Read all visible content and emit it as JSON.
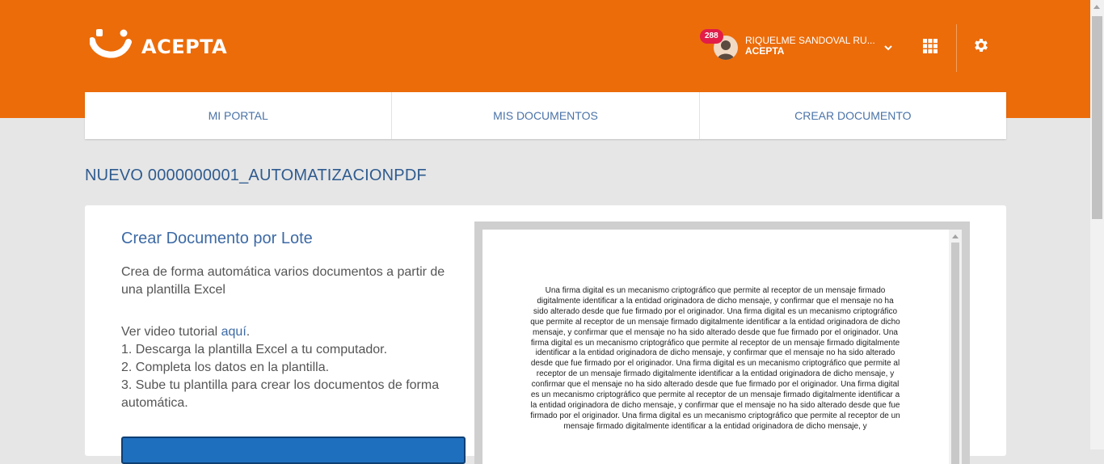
{
  "app": {
    "brand": "ACEPTA"
  },
  "header": {
    "notification_count": "288",
    "user_name": "RIQUELME SANDOVAL RU...",
    "user_org": "ACEPTA"
  },
  "nav": {
    "tabs": [
      {
        "label": "MI PORTAL"
      },
      {
        "label": "MIS DOCUMENTOS"
      },
      {
        "label": "CREAR DOCUMENTO"
      }
    ]
  },
  "page": {
    "title": "NUEVO 0000000001_AUTOMATIZACIONPDF"
  },
  "card": {
    "title": "Crear Documento por Lote",
    "description": "Crea de forma automática varios documentos a partir de una plantilla Excel",
    "tutorial_prefix": "Ver video tutorial ",
    "tutorial_link": "aquí",
    "tutorial_suffix": ".",
    "steps": [
      "1. Descarga la plantilla Excel a tu computador.",
      "2. Completa los datos en la plantilla.",
      "3. Sube tu plantilla para crear los documentos de forma automática."
    ]
  },
  "pdf_preview": {
    "text": "Una firma digital es un mecanismo criptográfico que permite al receptor de un mensaje firmado digitalmente identificar a la entidad originadora de dicho mensaje, y confirmar que el mensaje no ha sido alterado desde que fue firmado por el originador. Una firma digital es un mecanismo criptográfico que permite al receptor de un mensaje firmado digitalmente identificar a la entidad originadora de dicho mensaje, y confirmar que el mensaje no ha sido alterado desde que fue firmado por el originador. Una firma digital es un mecanismo criptográfico que permite al receptor de un mensaje firmado digitalmente identificar a la entidad originadora de dicho mensaje, y confirmar que el mensaje no ha sido alterado desde que fue firmado por el originador. Una firma digital es un mecanismo criptográfico que permite al receptor de un mensaje firmado digitalmente identificar a la entidad originadora de dicho mensaje, y confirmar que el mensaje no ha sido alterado desde que fue firmado por el originador. Una firma digital es un mecanismo criptográfico que permite al receptor de un mensaje firmado digitalmente identificar a la entidad originadora de dicho mensaje, y confirmar que el mensaje no ha sido alterado desde que fue firmado por el originador. Una firma digital es un mecanismo criptográfico que permite al receptor de un mensaje firmado digitalmente identificar a la entidad originadora de dicho mensaje, y"
  },
  "colors": {
    "brand_orange": "#ec6c0a",
    "link_blue": "#3d6aa5",
    "badge_red": "#e11d48",
    "button_blue": "#1f6fbf"
  },
  "icons": [
    "acepta-logo-icon",
    "user-avatar-icon",
    "chevron-down-icon",
    "apps-grid-icon",
    "gear-icon"
  ]
}
